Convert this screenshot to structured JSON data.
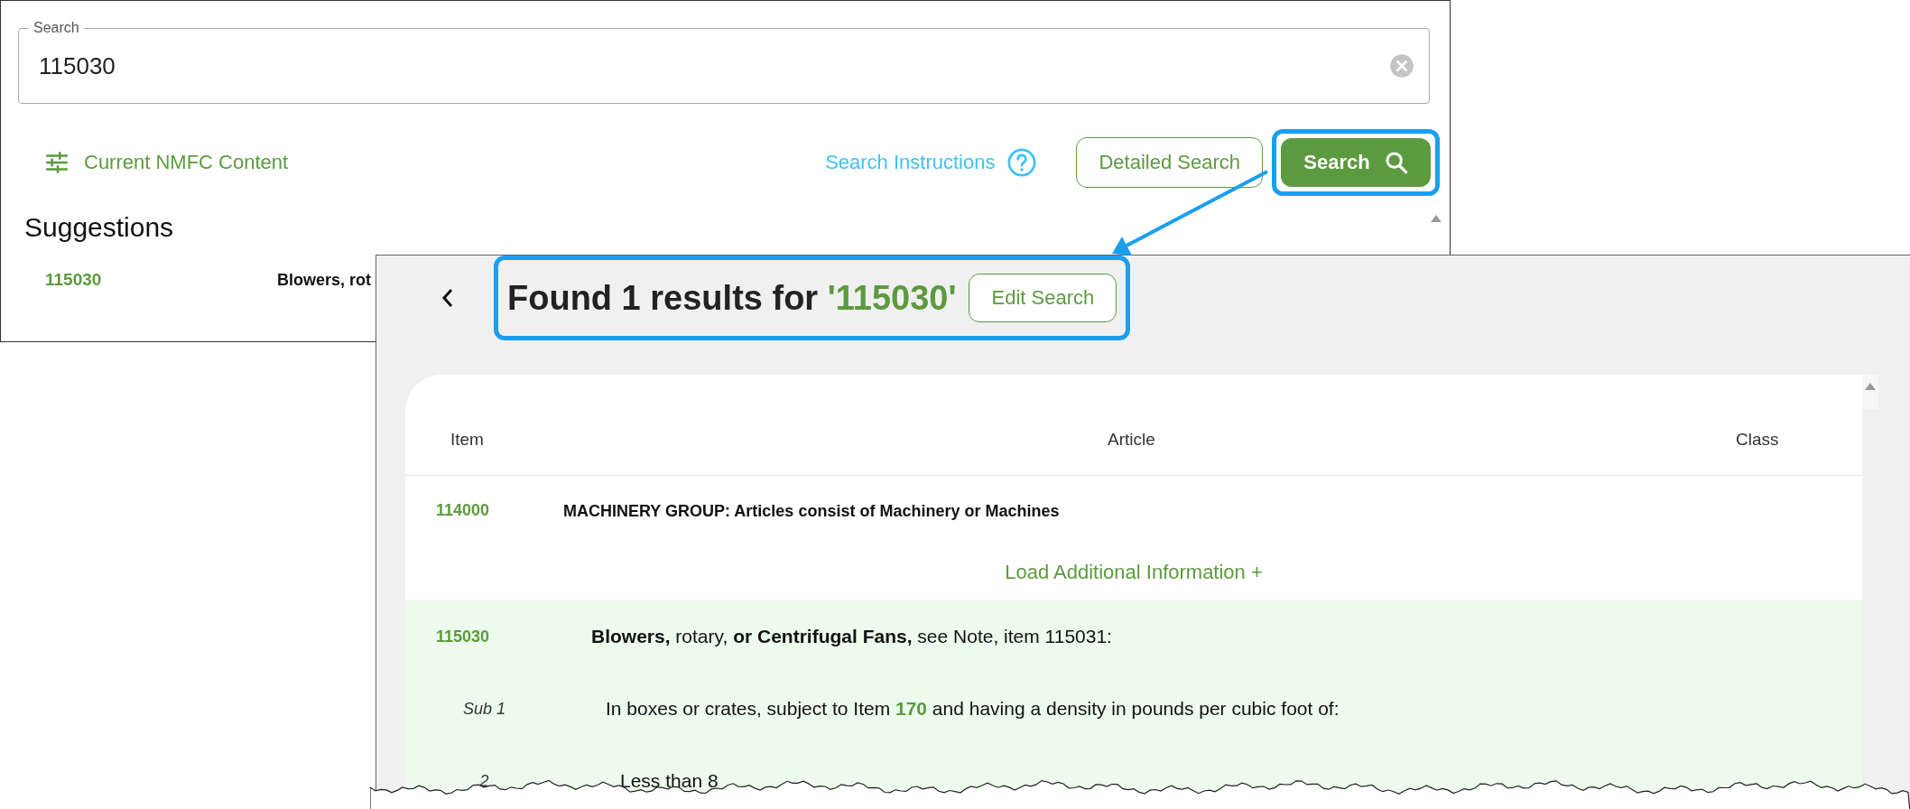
{
  "search_panel": {
    "search_field": {
      "label": "Search",
      "value": "115030"
    },
    "content_filter": "Current NMFC Content",
    "instructions_link": "Search Instructions",
    "buttons": [
      {
        "label": "Detailed Search",
        "kind": "outline",
        "highlighted": false
      },
      {
        "label": "Search",
        "kind": "primary",
        "highlighted": true
      }
    ],
    "suggestions_title": "Suggestions",
    "suggestions": [
      {
        "item": "115030",
        "article": "Blowers, rot"
      }
    ]
  },
  "results_panel": {
    "heading": "Found 1 results for",
    "query": "'115030'",
    "edit_button": "Edit Search",
    "heading_highlighted": true,
    "columns": [
      "Item",
      "Article",
      "Class"
    ],
    "rows": [
      {
        "kind": "group",
        "item": "114000",
        "article": "MACHINERY GROUP: Articles consist of Machinery or Machines",
        "highlighted": false
      },
      {
        "kind": "load_more",
        "label": "Load Additional Information +"
      },
      {
        "kind": "item",
        "item": "115030",
        "article": "**Blowers,** rotary, **or Centrifugal Fans,** see Note, item 115031:",
        "highlighted": true,
        "children": [
          {
            "kind": "sub",
            "item": "Sub 1",
            "article_before": "In boxes or crates, subject to Item ",
            "link": "170",
            "article_after": " and having a density in pounds per cubic foot of:",
            "highlighted": true,
            "children": [
              {
                "kind": "sub",
                "item": "2",
                "article_before": "Less than 8",
                "highlighted": true
              }
            ]
          }
        ]
      }
    ]
  }
}
